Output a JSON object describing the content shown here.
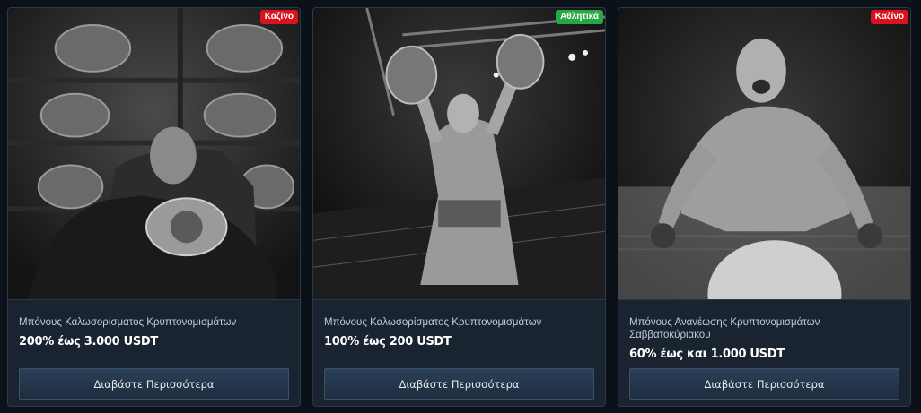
{
  "cards": [
    {
      "badge": "Καζίνο",
      "badge_color": "#d8121f",
      "title": "Μπόνους Καλωσορίσματος Κρυπτονομισμάτων",
      "value": "200% έως 3.000 USDT",
      "cta": "Διαβάστε Περισσότερα"
    },
    {
      "badge": "Αθλητικά",
      "badge_color": "#27a845",
      "title": "Μπόνους Καλωσορίσματος Κρυπτονομισμάτων",
      "value": "100% έως 200 USDT",
      "cta": "Διαβάστε Περισσότερα"
    },
    {
      "badge": "Καζίνο",
      "badge_color": "#d8121f",
      "title": "Μπόνους Ανανέωσης Κρυπτονομισμάτων Σαββατοκύριακου",
      "value": "60% έως και 1.000 USDT",
      "cta": "Διαβάστε Περισσότερα"
    }
  ]
}
